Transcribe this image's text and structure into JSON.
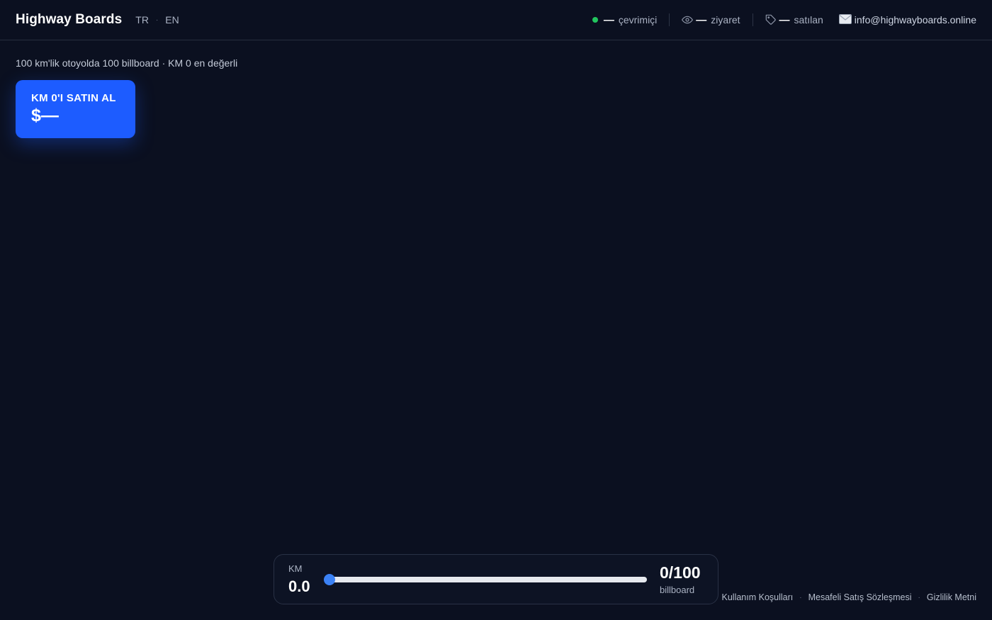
{
  "header": {
    "logo": "Highway Boards",
    "languages": [
      "TR",
      "EN"
    ],
    "lang_separator": "·",
    "stats": {
      "online_value": "—",
      "online_label": "çevrimiçi",
      "visits_value": "—",
      "visits_label": "ziyaret",
      "sold_value": "—",
      "sold_label": "satılan"
    },
    "email": "info@highwayboards.online"
  },
  "tagline": "100 km'lik otoyolda 100 billboard · KM 0 en değerli",
  "buy_button": {
    "label": "KM 0'I SATIN AL",
    "price": "$—"
  },
  "control": {
    "km_label": "KM",
    "km_value": "0.0",
    "slider_fraction": 0,
    "count": "0/100",
    "count_label": "billboard"
  },
  "footer": {
    "links": [
      "Kullanım Koşulları",
      "Mesafeli Satış Sözleşmesi",
      "Gizlilik Metni"
    ],
    "separator": "·"
  },
  "colors": {
    "background": "#0b1020",
    "accent": "#1d5cff",
    "slider": "#3b82f6",
    "online": "#22c55e"
  }
}
